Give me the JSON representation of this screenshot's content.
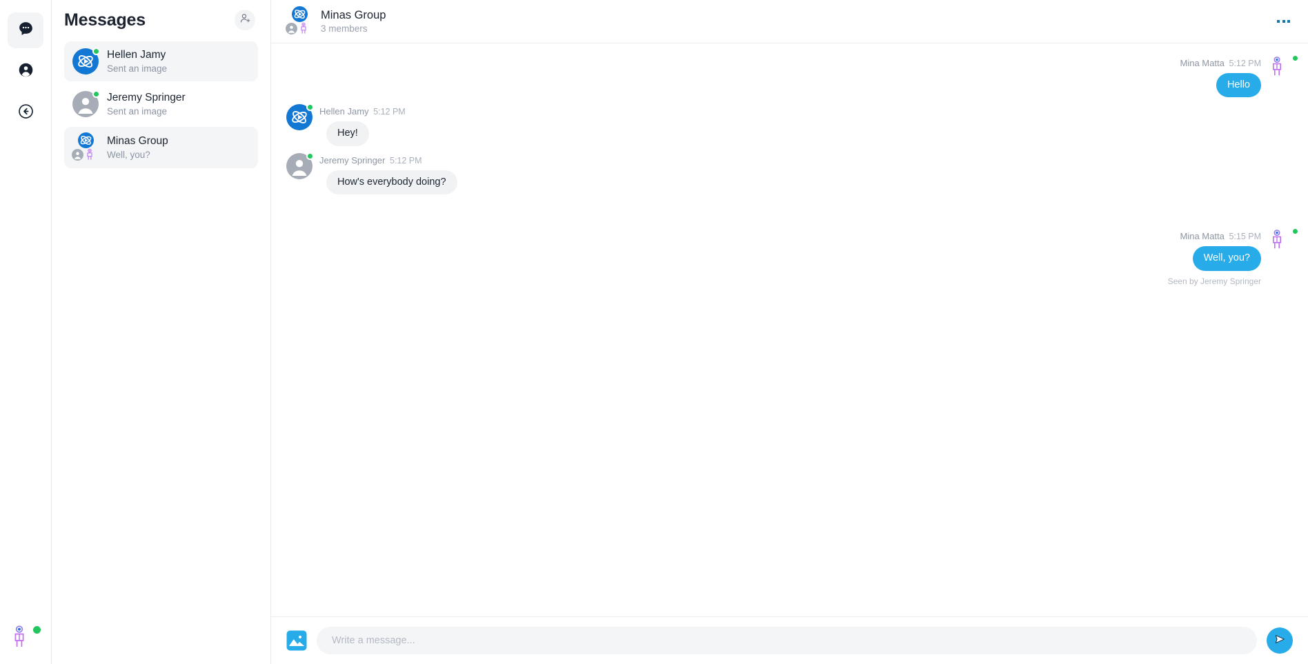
{
  "rail": {
    "items": [
      {
        "name": "chats",
        "icon": "chat-bubble-icon",
        "active": true
      },
      {
        "name": "profile",
        "icon": "user-circle-icon",
        "active": false
      },
      {
        "name": "back",
        "icon": "arrow-left-circle-icon",
        "active": false
      }
    ],
    "current_user": {
      "name": "Mina Matta",
      "avatar": "person-purple-icon",
      "status": "online"
    }
  },
  "list": {
    "title": "Messages",
    "add_person_label": "add-person",
    "conversations": [
      {
        "name": "Hellen Jamy",
        "preview": "Sent an image",
        "avatar": "brand-orbit-icon",
        "online": true,
        "selected": true,
        "group": false
      },
      {
        "name": "Jeremy Springer",
        "preview": "Sent an image",
        "avatar": "person-gray-icon",
        "online": true,
        "selected": false,
        "group": false
      },
      {
        "name": "Minas Group",
        "preview": "Well, you?",
        "avatar": "brand-orbit-icon",
        "online": false,
        "selected": true,
        "group": true
      }
    ]
  },
  "chat": {
    "title": "Minas Group",
    "subtitle": "3 members",
    "more_label": "more-options",
    "messages": [
      {
        "id": "m1",
        "sender": "Mina Matta",
        "time": "5:12 PM",
        "text": "Hello",
        "direction": "out",
        "avatar": "person-purple-icon",
        "online": true,
        "seen": ""
      },
      {
        "id": "m2",
        "sender": "Hellen Jamy",
        "time": "5:12 PM",
        "text": "Hey!",
        "direction": "in",
        "avatar": "brand-orbit-icon",
        "online": true,
        "seen": ""
      },
      {
        "id": "m3",
        "sender": "Jeremy Springer",
        "time": "5:12 PM",
        "text": "How's everybody doing?",
        "direction": "in",
        "avatar": "person-gray-icon",
        "online": true,
        "seen": ""
      },
      {
        "id": "m4",
        "sender": "Mina Matta",
        "time": "5:15 PM",
        "text": "Well, you?",
        "direction": "out",
        "avatar": "person-purple-icon",
        "online": true,
        "seen": "Seen by Jeremy Springer"
      }
    ]
  },
  "composer": {
    "image_label": "attach-image",
    "placeholder": "Write a message...",
    "value": "",
    "send_label": "send"
  },
  "colors": {
    "brand_blue": "#1377d4",
    "bubble_blue": "#28abe9",
    "online_green": "#22c55e",
    "bubble_gray": "#f1f2f4",
    "text_dark": "#1b2430",
    "text_muted": "#9aa2af",
    "purple": "#b96ef5"
  }
}
